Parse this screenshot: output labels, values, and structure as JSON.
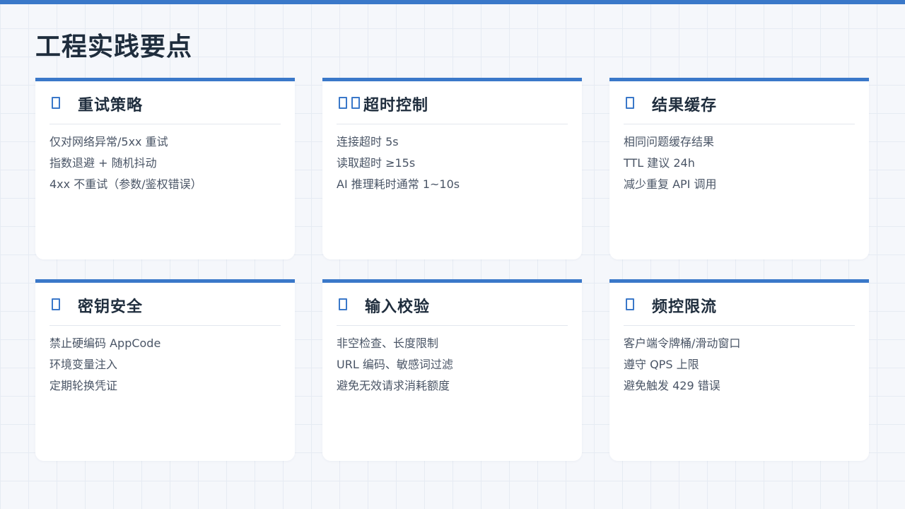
{
  "page": {
    "title": "工程实践要点",
    "accent_color": "#3a78c9",
    "background_color": "#f5f7fb"
  },
  "cards": [
    {
      "icon": "placeholder-glyph-icon",
      "title": "重试策略",
      "items": [
        "仅对网络异常/5xx 重试",
        "指数退避 + 随机抖动",
        "4xx 不重试（参数/鉴权错误）"
      ]
    },
    {
      "icon": "placeholder-glyph-icon",
      "title": "超时控制",
      "items": [
        "连接超时 5s",
        "读取超时 ≥15s",
        "AI 推理耗时通常 1~10s"
      ]
    },
    {
      "icon": "placeholder-glyph-icon",
      "title": "结果缓存",
      "items": [
        "相同问题缓存结果",
        "TTL 建议 24h",
        "减少重复 API 调用"
      ]
    },
    {
      "icon": "placeholder-glyph-icon",
      "title": "密钥安全",
      "items": [
        "禁止硬编码 AppCode",
        "环境变量注入",
        "定期轮换凭证"
      ]
    },
    {
      "icon": "placeholder-glyph-icon",
      "title": "输入校验",
      "items": [
        "非空检查、长度限制",
        "URL 编码、敏感词过滤",
        "避免无效请求消耗额度"
      ]
    },
    {
      "icon": "placeholder-glyph-icon",
      "title": "频控限流",
      "items": [
        "客户端令牌桶/滑动窗口",
        "遵守 QPS 上限",
        "避免触发 429 错误"
      ]
    }
  ]
}
